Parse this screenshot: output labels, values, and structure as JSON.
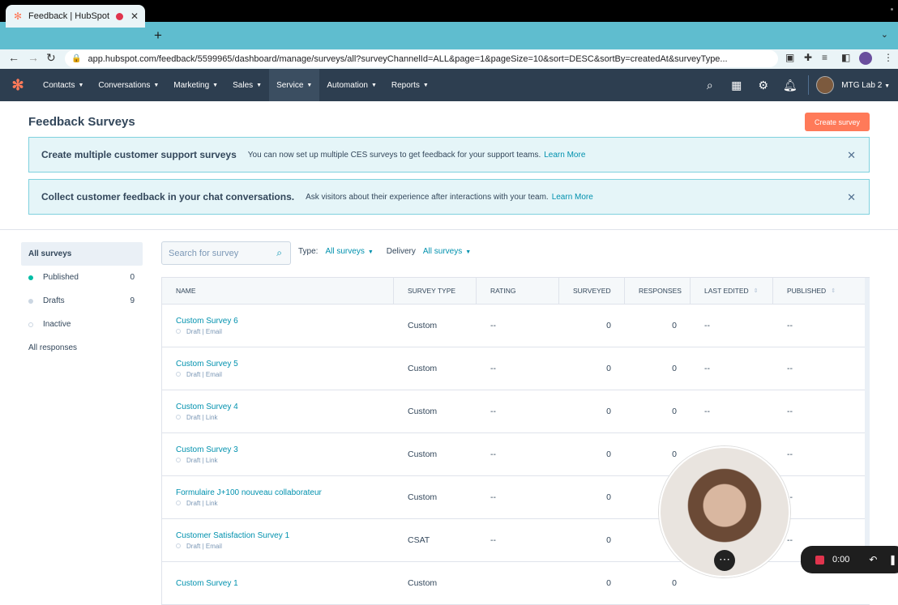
{
  "browser": {
    "tab_title": "Feedback | HubSpot",
    "url": "app.hubspot.com/feedback/5599965/dashboard/manage/surveys/all?surveyChannelId=ALL&page=1&pageSize=10&sort=DESC&sortBy=createdAt&surveyType..."
  },
  "nav": {
    "items": [
      {
        "label": "Contacts"
      },
      {
        "label": "Conversations"
      },
      {
        "label": "Marketing"
      },
      {
        "label": "Sales"
      },
      {
        "label": "Service"
      },
      {
        "label": "Automation"
      },
      {
        "label": "Reports"
      }
    ],
    "account": "MTG Lab 2"
  },
  "page": {
    "title": "Feedback Surveys",
    "create_button": "Create survey"
  },
  "banners": [
    {
      "title": "Create multiple customer support surveys",
      "text": "You can now set up multiple CES surveys to get feedback for your support teams.",
      "link": "Learn More"
    },
    {
      "title": "Collect customer feedback in your chat conversations.",
      "text": "Ask visitors about their experience after interactions with your team.",
      "link": "Learn More"
    }
  ],
  "sidebar": {
    "all_surveys": "All surveys",
    "items": [
      {
        "label": "Published",
        "count": "0",
        "color": "#00bda5"
      },
      {
        "label": "Drafts",
        "count": "9",
        "color": "#cbd6e2"
      },
      {
        "label": "Inactive",
        "count": "",
        "color": "#ffffff"
      }
    ],
    "all_responses": "All responses"
  },
  "filters": {
    "search_placeholder": "Search for survey",
    "type_label": "Type:",
    "type_value": "All surveys",
    "delivery_label": "Delivery",
    "delivery_value": "All surveys"
  },
  "table": {
    "columns": [
      "NAME",
      "SURVEY TYPE",
      "RATING",
      "SURVEYED",
      "RESPONSES",
      "LAST EDITED",
      "PUBLISHED"
    ],
    "rows": [
      {
        "name": "Custom Survey 6",
        "sub": "Draft | Email",
        "type": "Custom",
        "rating": "--",
        "surveyed": "0",
        "responses": "0",
        "last_edited": "--",
        "published": "--"
      },
      {
        "name": "Custom Survey 5",
        "sub": "Draft | Email",
        "type": "Custom",
        "rating": "--",
        "surveyed": "0",
        "responses": "0",
        "last_edited": "--",
        "published": "--"
      },
      {
        "name": "Custom Survey 4",
        "sub": "Draft | Link",
        "type": "Custom",
        "rating": "--",
        "surveyed": "0",
        "responses": "0",
        "last_edited": "--",
        "published": "--"
      },
      {
        "name": "Custom Survey 3",
        "sub": "Draft | Link",
        "type": "Custom",
        "rating": "--",
        "surveyed": "0",
        "responses": "0",
        "last_edited": "",
        "published": "--"
      },
      {
        "name": "Formulaire J+100 nouveau collaborateur",
        "sub": "Draft | Link",
        "type": "Custom",
        "rating": "--",
        "surveyed": "0",
        "responses": "",
        "last_edited": "",
        "published": "--"
      },
      {
        "name": "Customer Satisfaction Survey 1",
        "sub": "Draft | Email",
        "type": "CSAT",
        "rating": "--",
        "surveyed": "0",
        "responses": "",
        "last_edited": "",
        "published": "--"
      },
      {
        "name": "Custom Survey 1",
        "sub": "",
        "type": "Custom",
        "rating": "",
        "surveyed": "0",
        "responses": "0",
        "last_edited": "",
        "published": ""
      }
    ]
  },
  "recorder": {
    "time": "0:00"
  }
}
